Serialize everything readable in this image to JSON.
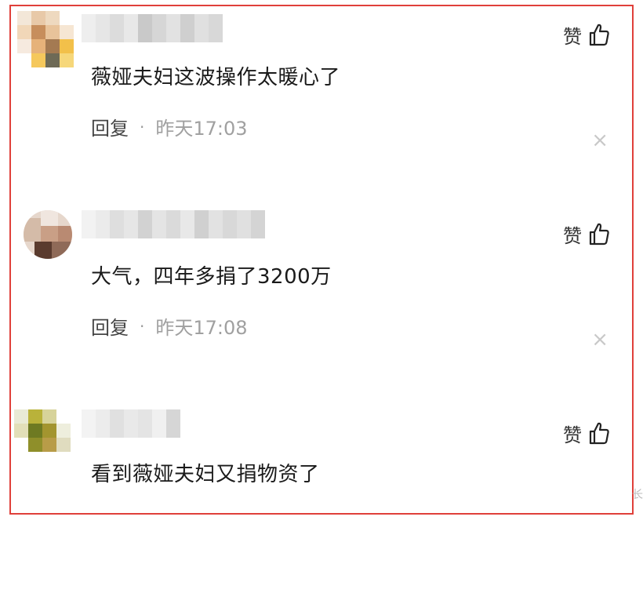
{
  "comments": [
    {
      "like_label": "赞",
      "text": "薇娅夫妇这波操作太暖心了",
      "reply_label": "回复",
      "separator": "·",
      "time": "昨天17:03",
      "close_glyph": "×"
    },
    {
      "like_label": "赞",
      "text": "大气，四年多捐了3200万",
      "reply_label": "回复",
      "separator": "·",
      "time": "昨天17:08",
      "close_glyph": "×"
    },
    {
      "like_label": "赞",
      "text": "看到薇娅夫妇又捐物资了"
    }
  ],
  "edge_char": "长",
  "colors": {
    "frame_border": "#e0403a",
    "text": "#1a1a1a",
    "time": "#a0a0a0"
  }
}
